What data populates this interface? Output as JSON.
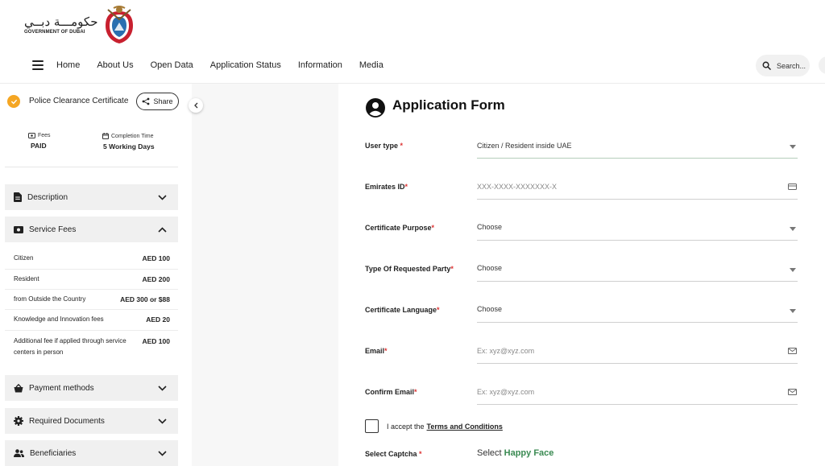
{
  "header": {
    "logo_arabic": "حكومـــة دبــي",
    "logo_english": "GOVERNMENT OF DUBAI",
    "nav": [
      "Home",
      "About Us",
      "Open Data",
      "Application Status",
      "Information",
      "Media"
    ],
    "search_label": "Search..."
  },
  "service": {
    "title": "Police Clearance Certificate",
    "share_label": "Share",
    "fees_label": "Fees",
    "fees_value": "PAID",
    "completion_label": "Completion Time",
    "completion_value": "5 Working Days"
  },
  "accordions": {
    "description": "Description",
    "service_fees": "Service Fees",
    "payment_methods": "Payment methods",
    "required_documents": "Required Documents",
    "beneficiaries": "Beneficiaries"
  },
  "fees": [
    {
      "label": "Citizen",
      "amount": "AED 100"
    },
    {
      "label": "Resident",
      "amount": "AED 200"
    },
    {
      "label": "from Outside the Country",
      "amount": "AED 300 or $88"
    },
    {
      "label": "Knowledge and Innovation fees",
      "amount": "AED 20"
    },
    {
      "label": "Additional fee if applied through service centers in person",
      "amount": "AED 100"
    }
  ],
  "form": {
    "title": "Application Form",
    "user_type_label": "User type",
    "user_type_value": "Citizen / Resident inside UAE",
    "emirates_id_label": "Emirates ID",
    "emirates_id_placeholder": "XXX-XXXX-XXXXXXX-X",
    "purpose_label": "Certificate Purpose",
    "purpose_value": "Choose",
    "party_label": "Type Of Requested Party",
    "party_value": "Choose",
    "language_label": "Certificate Language",
    "language_value": "Choose",
    "email_label": "Email",
    "email_placeholder": "Ex: xyz@xyz.com",
    "confirm_email_label": "Confirm Email",
    "confirm_email_placeholder": "Ex: xyz@xyz.com",
    "required_mark": "*",
    "terms_prefix": "I accept the",
    "terms_link": "Terms and Conditions",
    "captcha_label": "Select Captcha",
    "captcha_prefix": "Select",
    "captcha_target": "Happy Face"
  },
  "colors": {
    "accent_green": "#3a8a52",
    "badge_orange": "#f5a623",
    "required_red": "#d33333"
  }
}
